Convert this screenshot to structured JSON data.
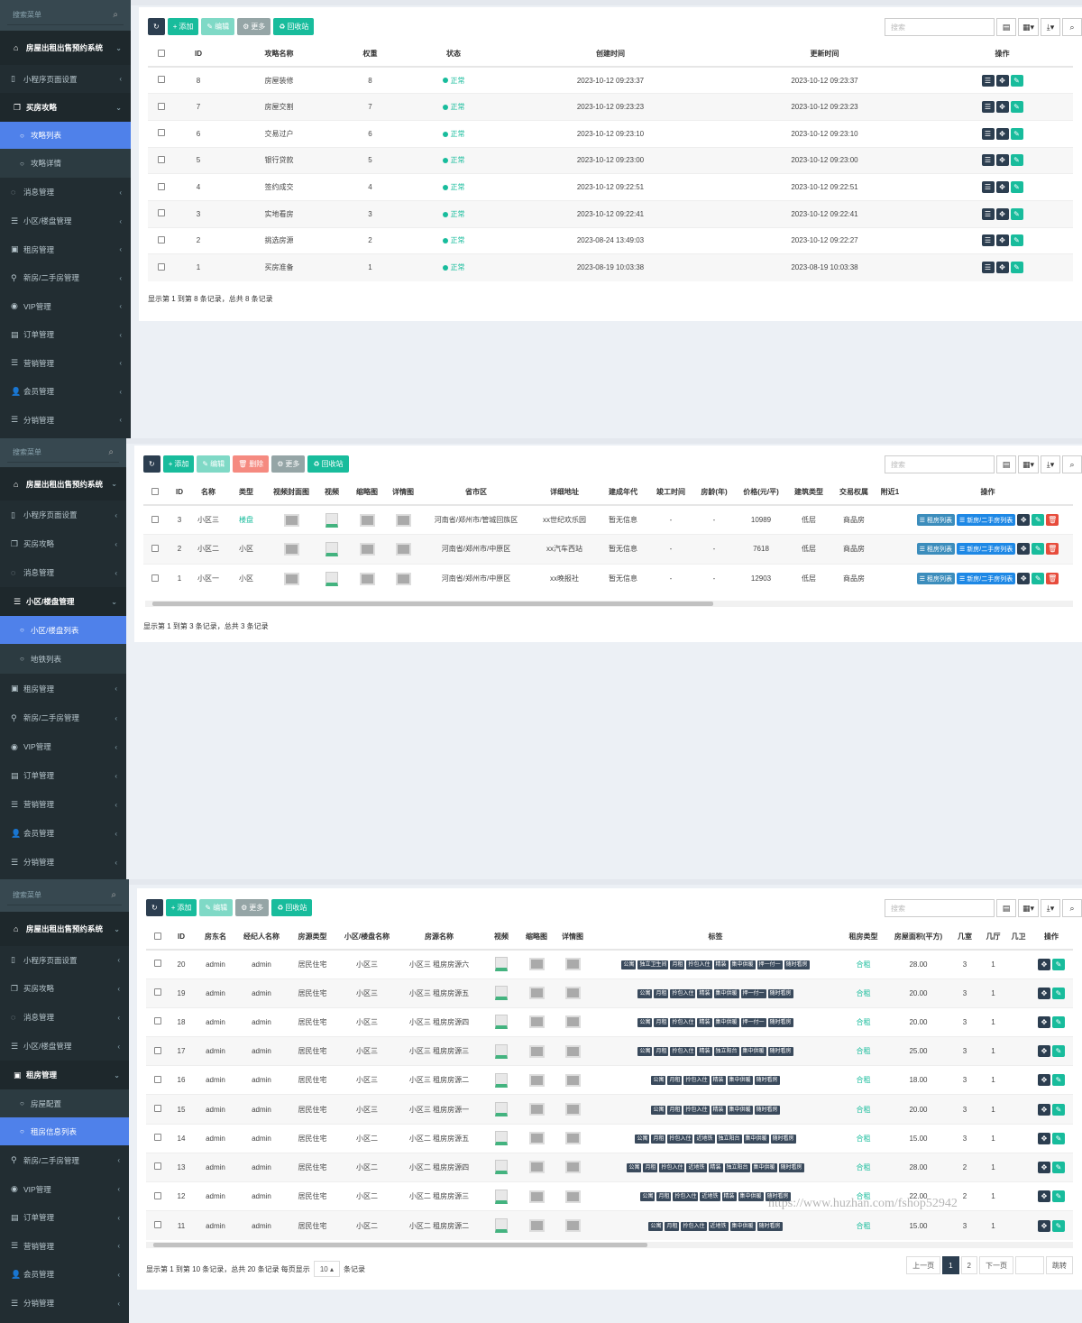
{
  "sidebar": {
    "search_placeholder": "搜索菜单",
    "system": "房屋出租出售预约系统",
    "items": {
      "miniprogram": "小程序页面设置",
      "guide": "买房攻略",
      "guide_list": "攻略列表",
      "guide_detail": "攻略详情",
      "message": "消息管理",
      "community": "小区/楼盘管理",
      "community_list": "小区/楼盘列表",
      "subway": "地铁列表",
      "rent": "租房管理",
      "rent_config": "房屋配置",
      "rent_list": "租房信息列表",
      "newhouse": "新房/二手房管理",
      "vip": "VIP管理",
      "order": "订单管理",
      "marketing": "营销管理",
      "member": "会员管理",
      "distribution": "分销管理"
    }
  },
  "toolbar": {
    "add": "添加",
    "edit": "编辑",
    "delete": "删除",
    "more": "更多",
    "recycle": "回收站",
    "search_placeholder": "搜索"
  },
  "panel1": {
    "headers": [
      "ID",
      "攻略名称",
      "权重",
      "状态",
      "创建时间",
      "更新时间",
      "操作"
    ],
    "rows": [
      {
        "id": "8",
        "name": "房屋装修",
        "weight": "8",
        "status": "正常",
        "created": "2023-10-12 09:23:37",
        "updated": "2023-10-12 09:23:37"
      },
      {
        "id": "7",
        "name": "房屋交割",
        "weight": "7",
        "status": "正常",
        "created": "2023-10-12 09:23:23",
        "updated": "2023-10-12 09:23:23"
      },
      {
        "id": "6",
        "name": "交易过户",
        "weight": "6",
        "status": "正常",
        "created": "2023-10-12 09:23:10",
        "updated": "2023-10-12 09:23:10"
      },
      {
        "id": "5",
        "name": "银行贷款",
        "weight": "5",
        "status": "正常",
        "created": "2023-10-12 09:23:00",
        "updated": "2023-10-12 09:23:00"
      },
      {
        "id": "4",
        "name": "签约成交",
        "weight": "4",
        "status": "正常",
        "created": "2023-10-12 09:22:51",
        "updated": "2023-10-12 09:22:51"
      },
      {
        "id": "3",
        "name": "实地看房",
        "weight": "3",
        "status": "正常",
        "created": "2023-10-12 09:22:41",
        "updated": "2023-10-12 09:22:41"
      },
      {
        "id": "2",
        "name": "挑选房源",
        "weight": "2",
        "status": "正常",
        "created": "2023-08-24 13:49:03",
        "updated": "2023-10-12 09:22:27"
      },
      {
        "id": "1",
        "name": "买房准备",
        "weight": "1",
        "status": "正常",
        "created": "2023-08-19 10:03:38",
        "updated": "2023-08-19 10:03:38"
      }
    ],
    "info": "显示第 1 到第 8 条记录，总共 8 条记录"
  },
  "panel2": {
    "headers": [
      "ID",
      "名称",
      "类型",
      "视频封面图",
      "视频",
      "缩略图",
      "详情图",
      "省市区",
      "详细地址",
      "建成年代",
      "竣工时间",
      "房龄(年)",
      "价格(元/平)",
      "建筑类型",
      "交易权属",
      "附近1",
      "操作"
    ],
    "rows": [
      {
        "id": "3",
        "name": "小区三",
        "type": "楼盘",
        "region": "河南省/郑州市/管城回族区",
        "address": "xx世纪欢乐园",
        "year": "暂无信息",
        "done": "-",
        "age": "-",
        "price": "10989",
        "btype": "低层",
        "right": "商品房"
      },
      {
        "id": "2",
        "name": "小区二",
        "type": "小区",
        "region": "河南省/郑州市/中原区",
        "address": "xx汽车西站",
        "year": "暂无信息",
        "done": "-",
        "age": "-",
        "price": "7618",
        "btype": "低层",
        "right": "商品房"
      },
      {
        "id": "1",
        "name": "小区一",
        "type": "小区",
        "region": "河南省/郑州市/中原区",
        "address": "xx晚报社",
        "year": "暂无信息",
        "done": "-",
        "age": "-",
        "price": "12903",
        "btype": "低层",
        "right": "商品房"
      }
    ],
    "op_rent": "租房列表",
    "op_new": "新房/二手房列表",
    "info": "显示第 1 到第 3 条记录，总共 3 条记录"
  },
  "panel3": {
    "headers": [
      "ID",
      "房东名",
      "经纪人名称",
      "房源类型",
      "小区/楼盘名称",
      "房源名称",
      "视频",
      "缩略图",
      "详情图",
      "标签",
      "租房类型",
      "房屋面积(平方)",
      "几室",
      "几厅",
      "几卫",
      "操作"
    ],
    "rows": [
      {
        "id": "20",
        "owner": "admin",
        "agent": "admin",
        "htype": "居民住宅",
        "community": "小区三",
        "name": "小区三 租房房源六",
        "tags": [
          "公寓",
          "独立卫生间",
          "月租",
          "拎包入住",
          "精装",
          "集中供暖",
          "押一付一",
          "随时看房"
        ],
        "rtype": "合租",
        "area": "28.00",
        "room": "3",
        "hall": "1"
      },
      {
        "id": "19",
        "owner": "admin",
        "agent": "admin",
        "htype": "居民住宅",
        "community": "小区三",
        "name": "小区三 租房房源五",
        "tags": [
          "公寓",
          "月租",
          "拎包入住",
          "精装",
          "集中供暖",
          "押一付一",
          "随时看房"
        ],
        "rtype": "合租",
        "area": "20.00",
        "room": "3",
        "hall": "1"
      },
      {
        "id": "18",
        "owner": "admin",
        "agent": "admin",
        "htype": "居民住宅",
        "community": "小区三",
        "name": "小区三 租房房源四",
        "tags": [
          "公寓",
          "月租",
          "拎包入住",
          "精装",
          "集中供暖",
          "押一付一",
          "随时看房"
        ],
        "rtype": "合租",
        "area": "20.00",
        "room": "3",
        "hall": "1"
      },
      {
        "id": "17",
        "owner": "admin",
        "agent": "admin",
        "htype": "居民住宅",
        "community": "小区三",
        "name": "小区三 租房房源三",
        "tags": [
          "公寓",
          "月租",
          "拎包入住",
          "精装",
          "独立阳台",
          "集中供暖",
          "随时看房"
        ],
        "rtype": "合租",
        "area": "25.00",
        "room": "3",
        "hall": "1"
      },
      {
        "id": "16",
        "owner": "admin",
        "agent": "admin",
        "htype": "居民住宅",
        "community": "小区三",
        "name": "小区三 租房房源二",
        "tags": [
          "公寓",
          "月租",
          "拎包入住",
          "精装",
          "集中供暖",
          "随时看房"
        ],
        "rtype": "合租",
        "area": "18.00",
        "room": "3",
        "hall": "1"
      },
      {
        "id": "15",
        "owner": "admin",
        "agent": "admin",
        "htype": "居民住宅",
        "community": "小区三",
        "name": "小区三 租房房源一",
        "tags": [
          "公寓",
          "月租",
          "拎包入住",
          "精装",
          "集中供暖",
          "随时看房"
        ],
        "rtype": "合租",
        "area": "20.00",
        "room": "3",
        "hall": "1"
      },
      {
        "id": "14",
        "owner": "admin",
        "agent": "admin",
        "htype": "居民住宅",
        "community": "小区二",
        "name": "小区二 租房房源五",
        "tags": [
          "公寓",
          "月租",
          "拎包入住",
          "近地铁",
          "独立阳台",
          "集中供暖",
          "随时看房"
        ],
        "rtype": "合租",
        "area": "15.00",
        "room": "3",
        "hall": "1"
      },
      {
        "id": "13",
        "owner": "admin",
        "agent": "admin",
        "htype": "居民住宅",
        "community": "小区二",
        "name": "小区二 租房房源四",
        "tags": [
          "公寓",
          "月租",
          "拎包入住",
          "近地铁",
          "精装",
          "独立阳台",
          "集中供暖",
          "随时看房"
        ],
        "rtype": "合租",
        "area": "28.00",
        "room": "2",
        "hall": "1"
      },
      {
        "id": "12",
        "owner": "admin",
        "agent": "admin",
        "htype": "居民住宅",
        "community": "小区二",
        "name": "小区二 租房房源三",
        "tags": [
          "公寓",
          "月租",
          "拎包入住",
          "近地铁",
          "精装",
          "集中供暖",
          "随时看房"
        ],
        "rtype": "合租",
        "area": "22.00",
        "room": "2",
        "hall": "1"
      },
      {
        "id": "11",
        "owner": "admin",
        "agent": "admin",
        "htype": "居民住宅",
        "community": "小区二",
        "name": "小区二 租房房源二",
        "tags": [
          "公寓",
          "月租",
          "拎包入住",
          "近地铁",
          "集中供暖",
          "随时看房"
        ],
        "rtype": "合租",
        "area": "15.00",
        "room": "3",
        "hall": "1"
      }
    ],
    "info": "显示第 1 到第 10 条记录，总共 20 条记录 每页显示",
    "page_size": "10",
    "info_suffix": "条记录",
    "prev": "上一页",
    "next": "下一页",
    "page1": "1",
    "page2": "2",
    "jump": "跳转",
    "watermark": "https://www.huzhan.com/fshop52942"
  }
}
